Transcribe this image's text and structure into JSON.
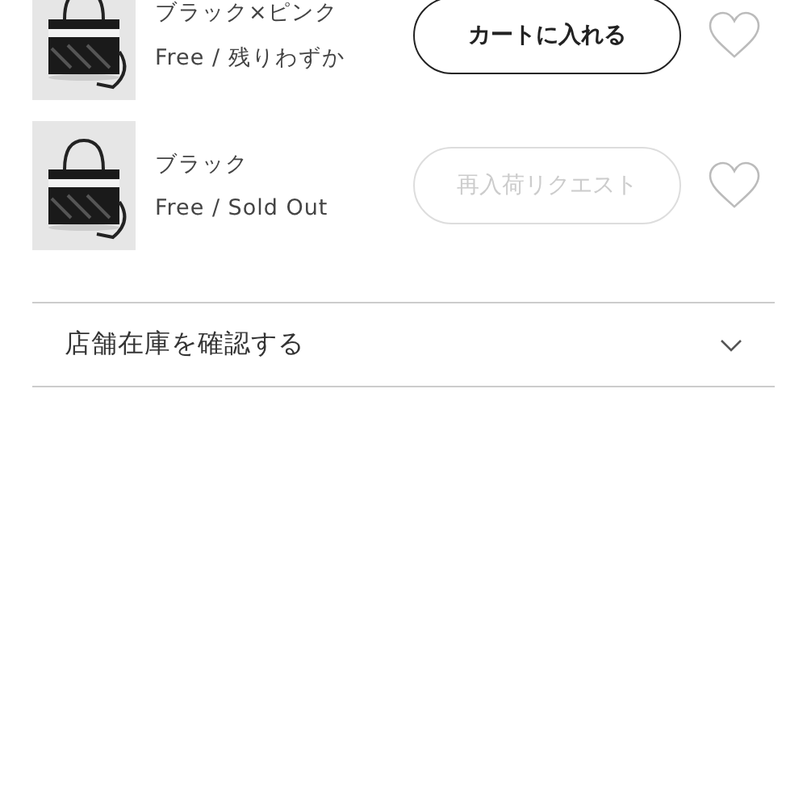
{
  "variants": [
    {
      "color_name": "ブラック×ピンク",
      "stock": "Free / 残りわずか",
      "button": {
        "label": "カートに入れる",
        "disabled": false
      }
    },
    {
      "color_name": "ブラック",
      "stock": "Free / Sold Out",
      "button": {
        "label": "再入荷リクエスト",
        "disabled": true
      }
    }
  ],
  "store_stock": {
    "label": "店舗在庫を確認する",
    "expanded": false
  }
}
